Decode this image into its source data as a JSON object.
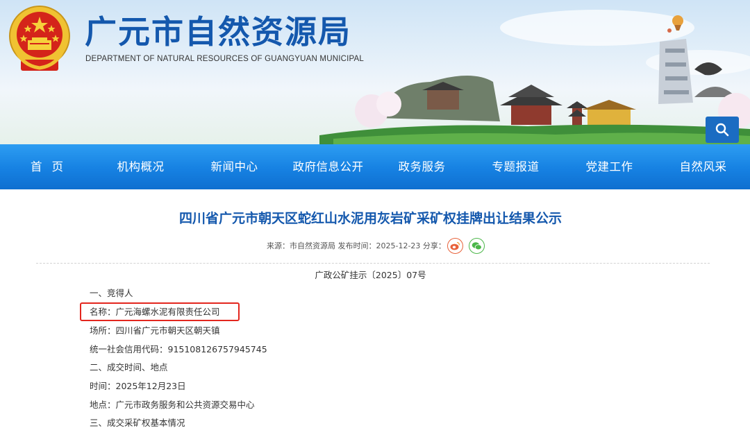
{
  "header": {
    "title": "广元市自然资源局",
    "subtitle": "DEPARTMENT OF NATURAL RESOURCES OF GUANGYUAN MUNICIPAL",
    "emblem_icon": "national-emblem-icon",
    "search_icon": "search-icon"
  },
  "nav": {
    "items": [
      "首页",
      "机构概况",
      "新闻中心",
      "政府信息公开",
      "政务服务",
      "专题报道",
      "党建工作",
      "自然风采"
    ]
  },
  "article": {
    "title": "四川省广元市朝天区蛇红山水泥用灰岩矿采矿权挂牌出让结果公示",
    "source_label": "来源：市自然资源局 发布时间：2025-12-23 分享：",
    "share_icons": [
      "weibo-icon",
      "wechat-icon"
    ],
    "doc_number": "广政公矿挂示〔2025〕07号",
    "lines": [
      "一、竞得人",
      "名称：广元海螺水泥有限责任公司",
      "场所：四川省广元市朝天区朝天镇",
      "统一社会信用代码：91510812675794574​5",
      "二、成交时间、地点",
      "时间：2025年12月23日",
      "地点：广元市政务服务和公共资源交易中心",
      "三、成交采矿权基本情况"
    ]
  },
  "colors": {
    "title_blue": "#1458ad",
    "nav_blue": "#1681e2",
    "highlight_red": "#e3261e"
  }
}
